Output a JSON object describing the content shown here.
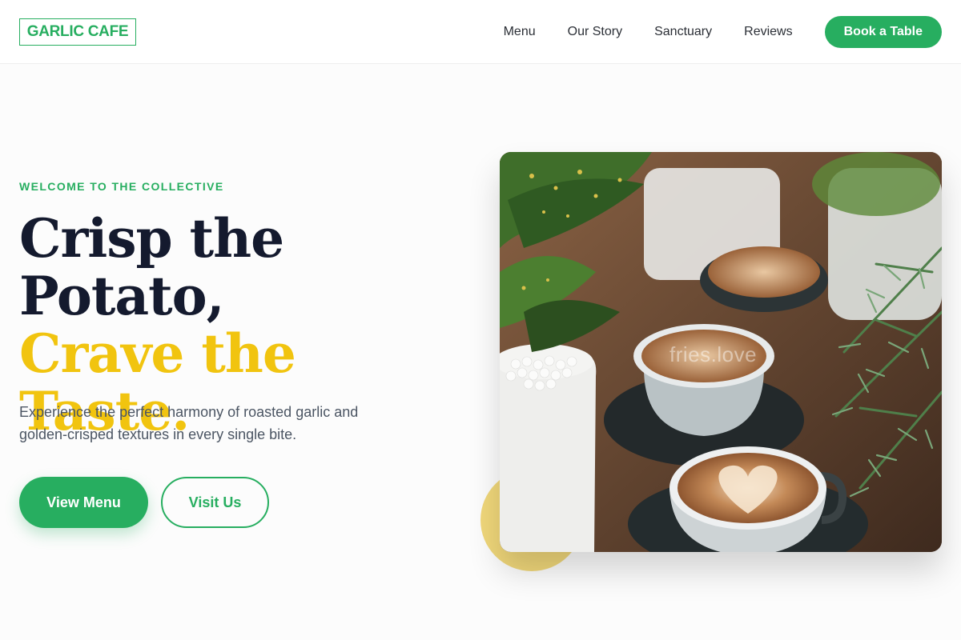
{
  "header": {
    "logo_text": "GARLIC CAFE",
    "nav": [
      {
        "label": "Menu"
      },
      {
        "label": "Our Story"
      },
      {
        "label": "Sanctuary"
      },
      {
        "label": "Reviews"
      }
    ],
    "cta_label": "Book a Table"
  },
  "hero": {
    "eyebrow": "WELCOME TO THE COLLECTIVE",
    "title_line1": "Crisp the",
    "title_line2": "Potato,",
    "title_accent": "Crave the Taste.",
    "subtitle": "Experience the perfect harmony of roasted garlic and golden-crisped textures in every single bite.",
    "primary_button": "View Menu",
    "secondary_button": "Visit Us",
    "image_watermark": "fries.love"
  },
  "colors": {
    "brand_green": "#27ae60",
    "accent_yellow": "#f1c40f",
    "heading_navy": "#141a2e"
  }
}
